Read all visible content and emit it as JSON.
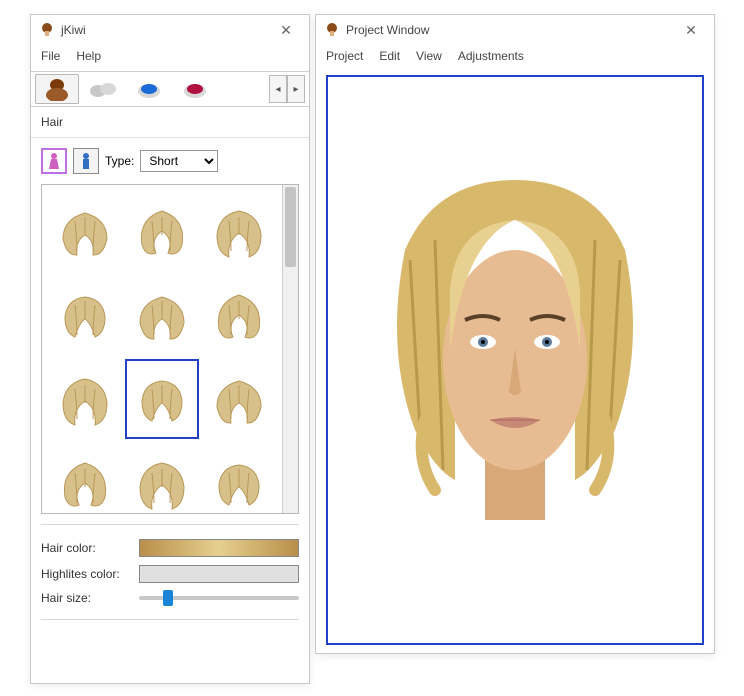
{
  "tool_window": {
    "title": "jKiwi",
    "menu": {
      "file": "File",
      "help": "Help"
    },
    "tabs": {
      "hair_icon": "hair-bun-icon",
      "makeup1_icon": "compact-icon",
      "makeup2_icon": "eyeshadow-icon",
      "makeup3_icon": "lipstick-icon"
    },
    "section_label": "Hair",
    "type_label": "Type:",
    "type_value": "Short",
    "gallery_count": 12,
    "selected_index": 7,
    "hair_color_label": "Hair color:",
    "highlites_label": "Highlites color:",
    "hair_size_label": "Hair size:",
    "slider_percent": 15
  },
  "project_window": {
    "title": "Project Window",
    "menu": {
      "project": "Project",
      "edit": "Edit",
      "view": "View",
      "adjustments": "Adjustments"
    }
  }
}
